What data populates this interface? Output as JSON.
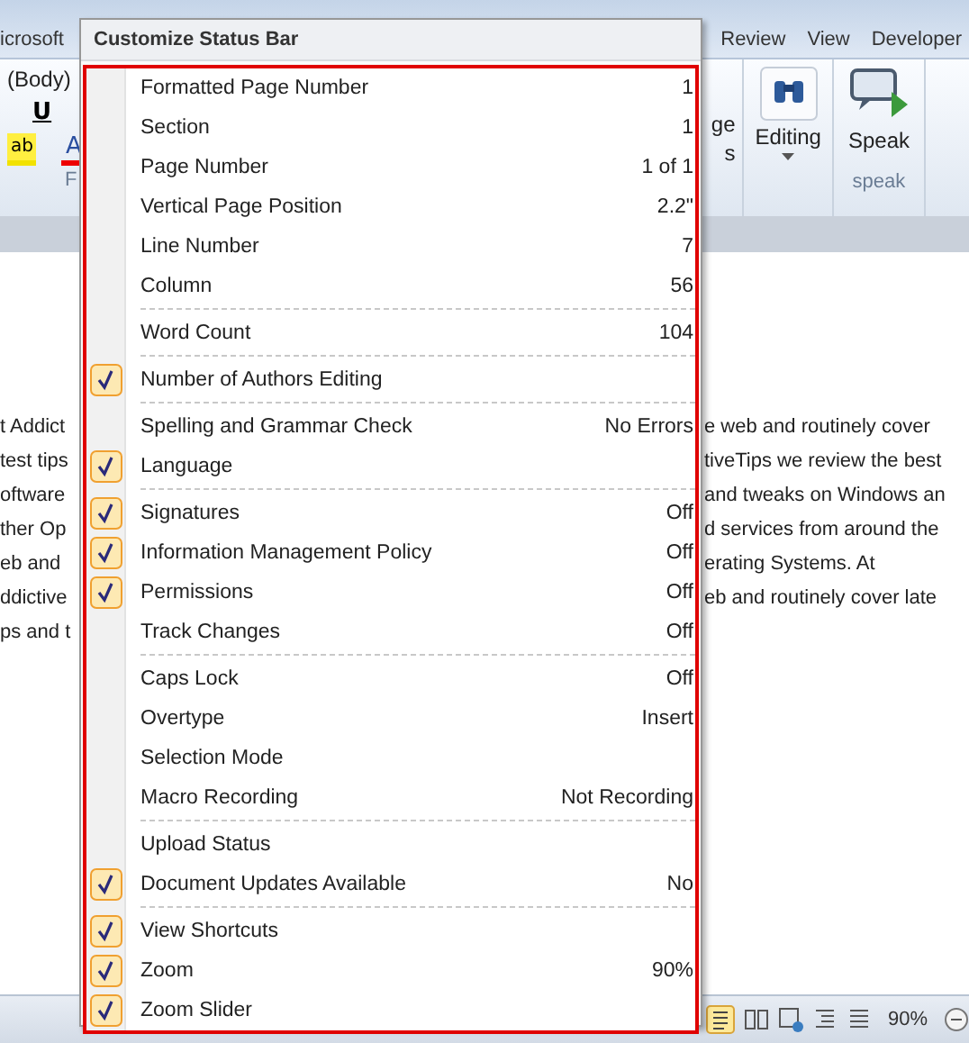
{
  "app_title": "icrosoft",
  "ribbon_tabs": [
    {
      "label": "Review"
    },
    {
      "label": "View"
    },
    {
      "label": "Developer"
    }
  ],
  "ribbon_left": {
    "font_name": "(Body)",
    "underline": "U",
    "highlight": "ab",
    "font_color": "A",
    "group_label": "F"
  },
  "ribbon_right": {
    "styles_fragment_1": "ge",
    "styles_fragment_2": "s",
    "editing": "Editing",
    "speak": "Speak",
    "speak_group": "speak"
  },
  "document": {
    "left_lines": [
      "t Addict",
      "test tips",
      "oftware",
      "ther Op",
      "eb and",
      "ddictive",
      "ps and t"
    ],
    "right_lines": [
      "e web and routinely cover",
      "tiveTips we review the best",
      "and tweaks on Windows an",
      "d services from around the",
      "erating Systems.  At",
      "eb and routinely cover late"
    ]
  },
  "status_bar": {
    "zoom": "90%"
  },
  "menu": {
    "title": "Customize Status Bar",
    "items": [
      {
        "label": "Formatted Page Number",
        "value": "1",
        "checked": false,
        "separator_before": false
      },
      {
        "label": "Section",
        "value": "1",
        "checked": false,
        "separator_before": false
      },
      {
        "label": "Page Number",
        "value": "1 of 1",
        "checked": false,
        "separator_before": false
      },
      {
        "label": "Vertical Page Position",
        "value": "2.2\"",
        "checked": false,
        "separator_before": false
      },
      {
        "label": "Line Number",
        "value": "7",
        "checked": false,
        "separator_before": false
      },
      {
        "label": "Column",
        "value": "56",
        "checked": false,
        "separator_before": false
      },
      {
        "label": "Word Count",
        "value": "104",
        "checked": false,
        "separator_before": true
      },
      {
        "label": "Number of Authors Editing",
        "checked": true,
        "separator_before": true
      },
      {
        "label": "Spelling and Grammar Check",
        "value": "No Errors",
        "checked": false,
        "separator_before": true
      },
      {
        "label": "Language",
        "checked": true,
        "separator_before": false
      },
      {
        "label": "Signatures",
        "value": "Off",
        "checked": true,
        "separator_before": true
      },
      {
        "label": "Information Management Policy",
        "value": "Off",
        "checked": true,
        "separator_before": false
      },
      {
        "label": "Permissions",
        "value": "Off",
        "checked": true,
        "separator_before": false
      },
      {
        "label": "Track Changes",
        "value": "Off",
        "checked": false,
        "separator_before": false
      },
      {
        "label": "Caps Lock",
        "value": "Off",
        "checked": false,
        "separator_before": true
      },
      {
        "label": "Overtype",
        "value": "Insert",
        "checked": false,
        "separator_before": false
      },
      {
        "label": "Selection Mode",
        "checked": false,
        "separator_before": false
      },
      {
        "label": "Macro Recording",
        "value": "Not Recording",
        "checked": false,
        "separator_before": false
      },
      {
        "label": "Upload Status",
        "checked": false,
        "separator_before": true
      },
      {
        "label": "Document Updates Available",
        "value": "No",
        "checked": true,
        "separator_before": false
      },
      {
        "label": "View Shortcuts",
        "checked": true,
        "separator_before": true
      },
      {
        "label": "Zoom",
        "value": "90%",
        "checked": true,
        "separator_before": false
      },
      {
        "label": "Zoom Slider",
        "checked": true,
        "separator_before": false
      }
    ]
  }
}
